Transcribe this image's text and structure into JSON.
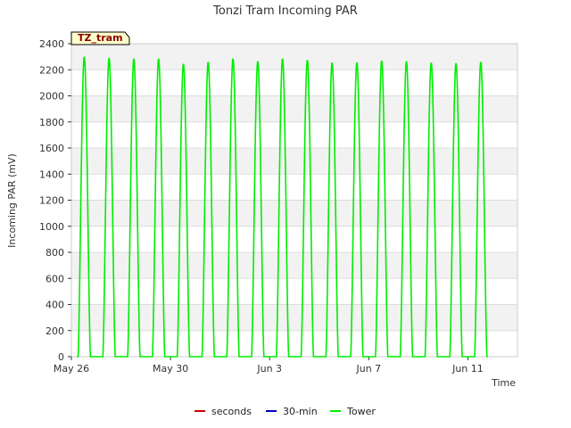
{
  "chart_data": {
    "type": "line",
    "title": "Tonzi Tram Incoming PAR",
    "xlabel": "Time",
    "ylabel": "Incoming PAR (mV)",
    "site_tag": "TZ_tram",
    "ylim": [
      0,
      2400
    ],
    "yticks": [
      0,
      200,
      400,
      600,
      800,
      1000,
      1200,
      1400,
      1600,
      1800,
      2000,
      2200,
      2400
    ],
    "xlim": [
      "2024-05-26",
      "2024-06-13"
    ],
    "xticks": [
      {
        "date": "2024-05-26",
        "label": "May 26"
      },
      {
        "date": "2024-05-30",
        "label": "May 30"
      },
      {
        "date": "2024-06-03",
        "label": "Jun 3"
      },
      {
        "date": "2024-06-07",
        "label": "Jun 7"
      },
      {
        "date": "2024-06-11",
        "label": "Jun 11"
      }
    ],
    "grid": true,
    "legend_position": "bottom",
    "series": [
      {
        "name": "seconds",
        "color": "#cc0000",
        "values": []
      },
      {
        "name": "30-min",
        "color": "#0000bb",
        "values": []
      },
      {
        "name": "Tower",
        "color": "#00ee00",
        "daily_peaks": [
          {
            "date": "2024-05-26",
            "peak": 2300
          },
          {
            "date": "2024-05-27",
            "peak": 2290
          },
          {
            "date": "2024-05-28",
            "peak": 2285
          },
          {
            "date": "2024-05-29",
            "peak": 2285
          },
          {
            "date": "2024-05-30",
            "peak": 2245
          },
          {
            "date": "2024-05-31",
            "peak": 2260
          },
          {
            "date": "2024-06-01",
            "peak": 2285
          },
          {
            "date": "2024-06-02",
            "peak": 2265
          },
          {
            "date": "2024-06-03",
            "peak": 2285
          },
          {
            "date": "2024-06-04",
            "peak": 2275
          },
          {
            "date": "2024-06-05",
            "peak": 2255
          },
          {
            "date": "2024-06-06",
            "peak": 2255
          },
          {
            "date": "2024-06-07",
            "peak": 2270
          },
          {
            "date": "2024-06-08",
            "peak": 2265
          },
          {
            "date": "2024-06-09",
            "peak": 2255
          },
          {
            "date": "2024-06-10",
            "peak": 2250
          },
          {
            "date": "2024-06-11",
            "peak": 2260
          }
        ]
      }
    ]
  }
}
